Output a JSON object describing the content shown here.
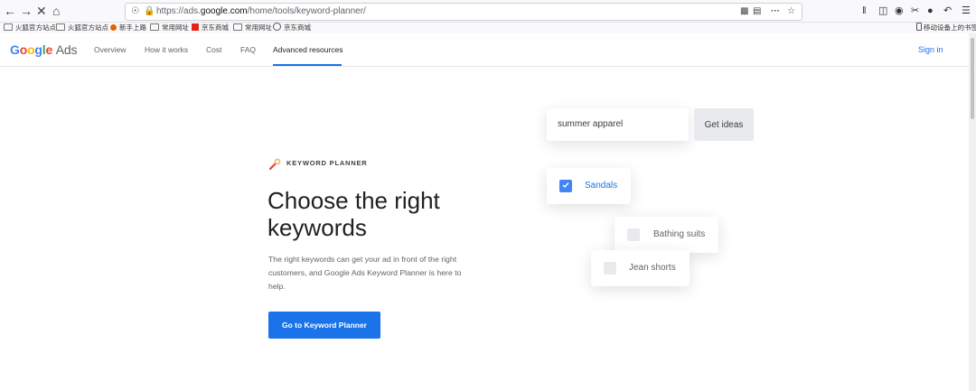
{
  "browser": {
    "url_scheme": "https://ads.",
    "url_host": "google.com",
    "url_path": "/home/tools/keyword-planner/",
    "more_label": "···",
    "bookmarks": [
      "火狐官方站点",
      "火狐官方站点",
      "新手上路",
      "常用网址",
      "京东商城",
      "常用网址",
      "京东商城"
    ],
    "mobile_bookmarks": "移动设备上的书签"
  },
  "header": {
    "logo_google": "Google",
    "logo_ads": "Ads",
    "nav": [
      "Overview",
      "How it works",
      "Cost",
      "FAQ",
      "Advanced resources"
    ],
    "signin": "Sign in"
  },
  "hero": {
    "eyebrow": "KEYWORD PLANNER",
    "headline": "Choose the right keywords",
    "description": "The right keywords can get your ad in front of the right customers, and Google Ads Keyword Planner is here to help.",
    "cta": "Go to Keyword Planner"
  },
  "illustration": {
    "search_value": "summer apparel",
    "ideas_button": "Get ideas",
    "options": [
      {
        "label": "Sandals",
        "checked": true
      },
      {
        "label": "Bathing suits",
        "checked": false
      },
      {
        "label": "Jean shorts",
        "checked": false
      }
    ]
  },
  "colors": {
    "accent": "#1a73e8",
    "checkbox_checked": "#4285f4",
    "google_blue": "#4285f4",
    "google_red": "#ea4335",
    "google_yellow": "#fbbc05",
    "google_green": "#34a853"
  }
}
